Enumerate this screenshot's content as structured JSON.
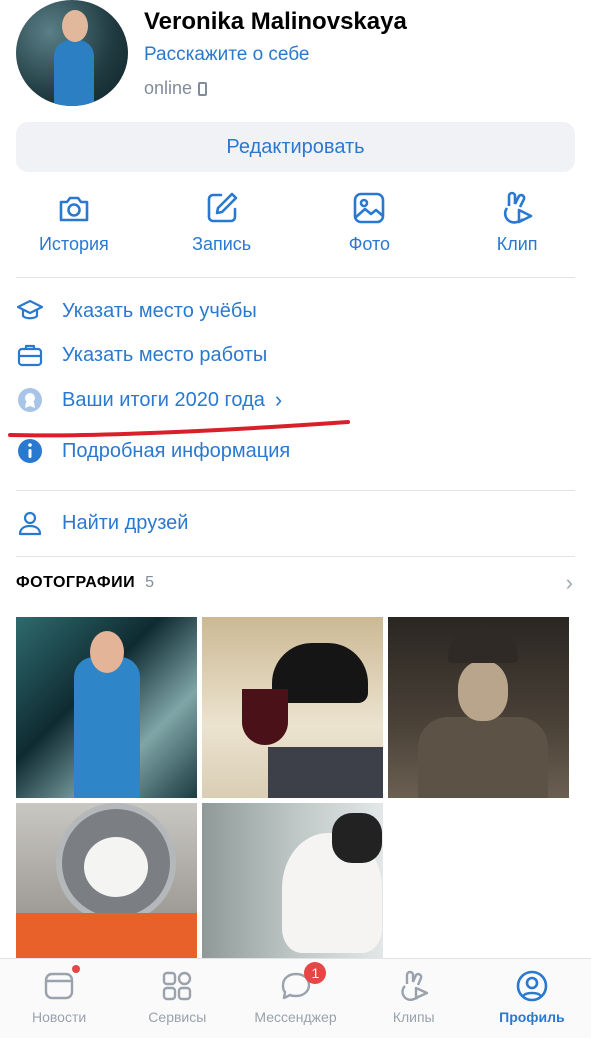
{
  "profile": {
    "name": "Veronika Malinovskaya",
    "about_link": "Расскажите о себе",
    "status": "online"
  },
  "edit_button": "Редактировать",
  "quick_actions": [
    {
      "label": "История",
      "icon": "camera-icon"
    },
    {
      "label": "Запись",
      "icon": "edit-icon"
    },
    {
      "label": "Фото",
      "icon": "photo-icon"
    },
    {
      "label": "Клип",
      "icon": "clip-icon"
    }
  ],
  "info_items": [
    {
      "label": "Указать место учёбы",
      "icon": "education-icon"
    },
    {
      "label": "Указать место работы",
      "icon": "briefcase-icon"
    },
    {
      "label": "Ваши итоги 2020 года",
      "icon": "award-icon",
      "chevron": "›"
    },
    {
      "label": "Подробная информация",
      "icon": "info-icon"
    },
    {
      "label": "Найти друзей",
      "icon": "user-icon"
    }
  ],
  "photos": {
    "title": "ФОТОГРАФИИ",
    "count": "5",
    "chevron": "›"
  },
  "tabbar": [
    {
      "label": "Новости",
      "icon": "news-icon",
      "dot": true
    },
    {
      "label": "Сервисы",
      "icon": "services-icon"
    },
    {
      "label": "Мессенджер",
      "icon": "messenger-icon",
      "badge": "1"
    },
    {
      "label": "Клипы",
      "icon": "clips-icon"
    },
    {
      "label": "Профиль",
      "icon": "profile-icon",
      "active": true
    }
  ],
  "colors": {
    "accent": "#2a79d1",
    "secondary_text": "#818c99",
    "badge": "#e64646",
    "annotation_line": "#d81f2a"
  }
}
